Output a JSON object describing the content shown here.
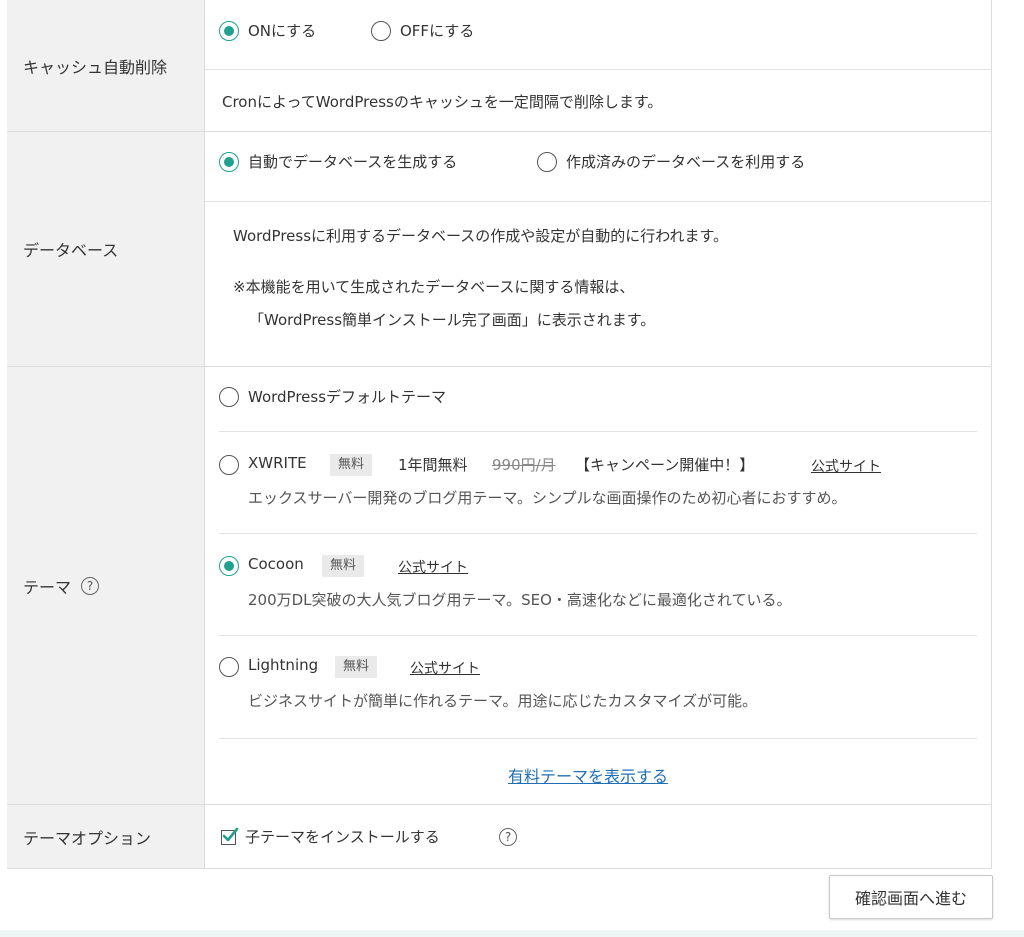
{
  "cache": {
    "label": "キャッシュ自動削除",
    "option_on": "ONにする",
    "option_off": "OFFにする",
    "description": "CronによってWordPressのキャッシュを一定間隔で削除します。"
  },
  "database": {
    "label": "データベース",
    "option_auto": "自動でデータベースを生成する",
    "option_existing": "作成済みのデータベースを利用する",
    "desc1": "WordPressに利用するデータベースの作成や設定が自動的に行われます。",
    "desc2": "※本機能を用いて生成されたデータベースに関する情報は、",
    "desc3": "「WordPress簡単インストール完了画面」に表示されます。"
  },
  "theme": {
    "label": "テーマ",
    "help_icon": "?",
    "default_option": "WordPressデフォルトテーマ",
    "xwrite": {
      "name": "XWRITE",
      "badge": "無料",
      "promo": "1年間無料",
      "old_price": "990円/月",
      "campaign": "【キャンペーン開催中！】",
      "link": "公式サイト",
      "desc": "エックスサーバー開発のブログ用テーマ。シンプルな画面操作のため初心者におすすめ。"
    },
    "cocoon": {
      "name": "Cocoon",
      "badge": "無料",
      "link": "公式サイト",
      "desc": "200万DL突破の大人気ブログ用テーマ。SEO・高速化などに最適化されている。"
    },
    "lightning": {
      "name": "Lightning",
      "badge": "無料",
      "link": "公式サイト",
      "desc": "ビジネスサイトが簡単に作れるテーマ。用途に応じたカスタマイズが可能。"
    },
    "show_paid": "有料テーマを表示する"
  },
  "theme_option": {
    "label": "テーマオプション",
    "checkbox_label": "子テーマをインストールする",
    "help_icon": "?"
  },
  "submit_label": "確認画面へ進む",
  "colors": {
    "accent": "#20a08f",
    "link_blue": "#1f6fb5"
  }
}
